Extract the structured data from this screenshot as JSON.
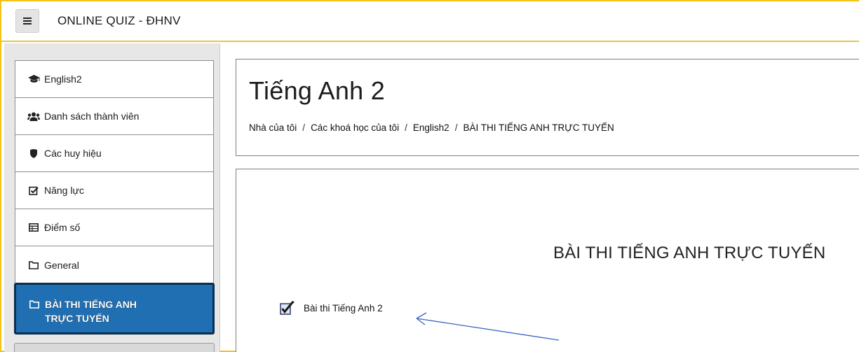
{
  "navbar": {
    "site_title": "ONLINE QUIZ - ĐHNV",
    "menu_icon": "hamburger-icon"
  },
  "sidebar": {
    "items": [
      {
        "label": "English2",
        "icon": "graduation-cap-icon"
      },
      {
        "label": "Danh sách thành viên",
        "icon": "users-icon"
      },
      {
        "label": "Các huy hiệu",
        "icon": "shield-icon"
      },
      {
        "label": "Năng lực",
        "icon": "check-square-icon"
      },
      {
        "label": "Điểm số",
        "icon": "table-icon"
      },
      {
        "label": "General",
        "icon": "folder-icon"
      }
    ],
    "active_item": {
      "line1": "BÀI THI TIẾNG ANH",
      "line2": "TRỰC TUYẾN",
      "icon": "folder-icon"
    }
  },
  "header": {
    "title": "Tiếng Anh 2",
    "breadcrumb": [
      "Nhà của tôi",
      "Các khoá học của tôi",
      "English2",
      "BÀI THI TIẾNG ANH TRỰC TUYẾN"
    ],
    "separator": "/"
  },
  "content": {
    "section_title": "BÀI THI TIẾNG ANH TRỰC TUYẾN",
    "quiz_link": "Bài thi Tiếng Anh 2",
    "quiz_icon": "quiz-checkbox-icon"
  },
  "colors": {
    "frame_border": "#f5c21a",
    "active_bg": "#1f6fb2",
    "active_border": "#0c2e4e",
    "arrow": "#3a63c7"
  }
}
